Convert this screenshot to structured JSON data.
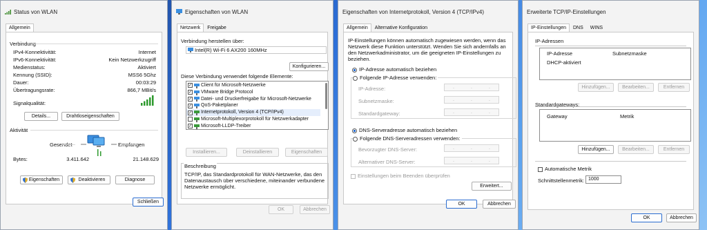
{
  "w1": {
    "title": "Status von WLAN",
    "tab": "Allgemein",
    "conn_label": "Verbindung",
    "rows": [
      [
        "IPv4-Konnektivität:",
        "Internet"
      ],
      [
        "IPv6-Konnektivität:",
        "Kein Netzwerkzugriff"
      ],
      [
        "Medienstatus:",
        "Aktiviert"
      ],
      [
        "Kennung (SSID):",
        "MSS6 5Ghz"
      ],
      [
        "Dauer:",
        "00:03:29"
      ],
      [
        "Übertragungsrate:",
        "866,7 MBit/s"
      ]
    ],
    "signal_label": "Signalqualität:",
    "signal_level": 1.0,
    "details": "Details...",
    "wifi_props": "Drahtloseigenschaften",
    "activity_label": "Aktivität",
    "sent": "Gesendet",
    "received": "Empfangen",
    "bytes_label": "Bytes:",
    "bytes_sent": "3.411.642",
    "bytes_received": "21.148.629",
    "props": "Eigenschaften",
    "deactivate": "Deaktivieren",
    "diagnose": "Diagnose",
    "close": "Schließen"
  },
  "w2": {
    "title": "Eigenschaften von WLAN",
    "tabs": [
      "Netzwerk",
      "Freigabe"
    ],
    "connect_using": "Verbindung herstellen über:",
    "adapter": "Intel(R) Wi-Fi 6 AX200 160MHz",
    "configure": "Konfigurieren...",
    "elements_label": "Diese Verbindung verwendet folgende Elemente:",
    "items": [
      {
        "label": "Client für Microsoft-Netzwerke",
        "checked": true
      },
      {
        "label": "VMware Bridge Protocol",
        "checked": true
      },
      {
        "label": "Datei- und Druckerfreigabe für Microsoft-Netzwerke",
        "checked": true
      },
      {
        "label": "QoS-Paketplaner",
        "checked": true
      },
      {
        "label": "Internetprotokoll, Version 4 (TCP/IPv4)",
        "checked": true
      },
      {
        "label": "Microsoft-Multiplexorprotokoll für Netzwerkadapter",
        "checked": false
      },
      {
        "label": "Microsoft-LLDP-Treiber",
        "checked": true
      }
    ],
    "install": "Installieren...",
    "uninstall": "Deinstallieren",
    "properties": "Eigenschaften",
    "desc_label": "Beschreibung",
    "desc": "TCP/IP, das Standardprotokoll für WAN-Netzwerke, das den Datenaustausch über verschiedene, miteinander verbundene Netzwerke ermöglicht.",
    "ok": "OK",
    "cancel": "Abbrechen"
  },
  "w3": {
    "title": "Eigenschaften von Internetprotokoll, Version 4 (TCP/IPv4)",
    "tabs": [
      "Allgemein",
      "Alternative Konfiguration"
    ],
    "intro": "IP-Einstellungen können automatisch zugewiesen werden, wenn das Netzwerk diese Funktion unterstützt. Wenden Sie sich andernfalls an den Netzwerkadministrator, um die geeigneten IP-Einstellungen zu beziehen.",
    "ip_auto": "IP-Adresse automatisch beziehen",
    "ip_manual": "Folgende IP-Adresse verwenden:",
    "ip": "IP-Adresse:",
    "mask": "Subnetzmaske:",
    "gw": "Standardgateway:",
    "dns_auto": "DNS-Serveradresse automatisch beziehen",
    "dns_manual": "Folgende DNS-Serveradressen verwenden:",
    "dns1": "Bevorzugter DNS-Server:",
    "dns2": "Alternativer DNS-Server:",
    "validate": "Einstellungen beim Beenden überprüfen",
    "advanced": "Erweitert...",
    "ok": "OK",
    "cancel": "Abbrechen"
  },
  "w4": {
    "title": "Erweiterte TCP/IP-Einstellungen",
    "tabs": [
      "IP-Einstellungen",
      "DNS",
      "WINS"
    ],
    "ip_group": "IP-Adressen",
    "col_ip": "IP-Adresse",
    "col_mask": "Subnetzmaske",
    "dhcp": "DHCP-aktiviert",
    "add": "Hinzufügen...",
    "edit": "Bearbeiten...",
    "remove": "Entfernen",
    "gw_group": "Standardgateways:",
    "col_gw": "Gateway",
    "col_metric": "Metrik",
    "auto_metric": "Automatische Metrik",
    "if_metric_label": "Schnittstellenmetrik:",
    "if_metric": "1000",
    "ok": "OK",
    "cancel": "Abbrechen"
  }
}
